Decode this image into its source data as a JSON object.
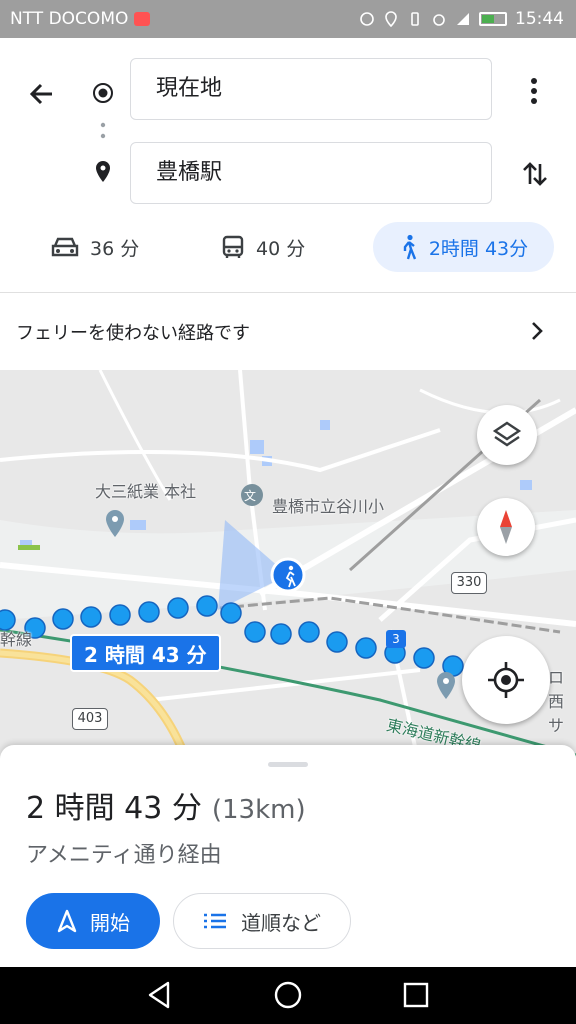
{
  "status_bar": {
    "carrier": "NTT DOCOMO",
    "time": "15:44"
  },
  "directions": {
    "origin": "現在地",
    "destination": "豊橋駅",
    "modes": [
      {
        "icon": "car-icon",
        "label": "36 分"
      },
      {
        "icon": "bus-icon",
        "label": "40 分"
      },
      {
        "icon": "walk-icon",
        "label": "2時間 43分",
        "selected": true
      }
    ]
  },
  "notice": {
    "text": "フェリーを使わない経路です"
  },
  "map": {
    "labels": {
      "company": "大三紙業 本社",
      "school": "豊橋市立谷川小",
      "line_left": "幹線",
      "shinkansen": "東海道新幹線",
      "right_edge_1": "ロー",
      "right_edge_2": "西サ"
    },
    "route_badge": "2 時間 43 分",
    "road_shields": [
      "330",
      "403",
      "3"
    ],
    "route_color": "#1a73e8"
  },
  "summary": {
    "time": "2 時間 43 分",
    "distance": "(13km)",
    "via": "アメニティ通り経由",
    "start_label": "開始",
    "steps_label": "道順など"
  }
}
